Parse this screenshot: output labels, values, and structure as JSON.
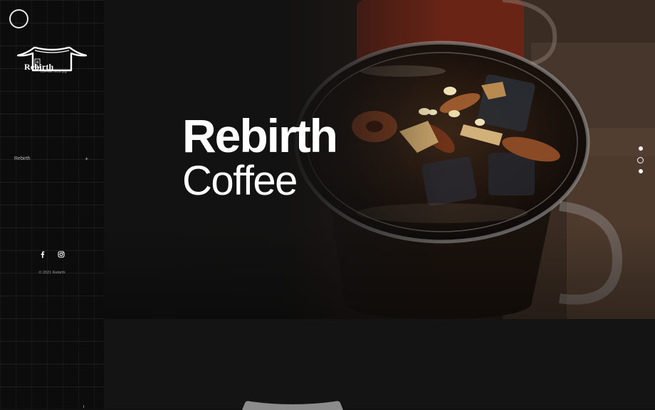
{
  "sidebar": {
    "menu_toggle": "menu-circle-icon",
    "logo": {
      "name": "Rebirth",
      "subtitle": "COFFEE 그리고 빵집"
    },
    "nav": [
      {
        "label": "Rebirth",
        "expand_symbol": "+"
      }
    ],
    "social": [
      {
        "icon": "facebook-icon"
      },
      {
        "icon": "instagram-icon"
      }
    ],
    "copyright": "© 2021 Rebirth"
  },
  "hero": {
    "title": "Rebirth",
    "subtitle": "Coffee",
    "slides": {
      "count": 3,
      "active_index": 1
    }
  },
  "colors": {
    "background": "#111111",
    "sidebar": "#0c0c0c",
    "text": "#ffffff",
    "muted_text": "#9b9b9b"
  }
}
